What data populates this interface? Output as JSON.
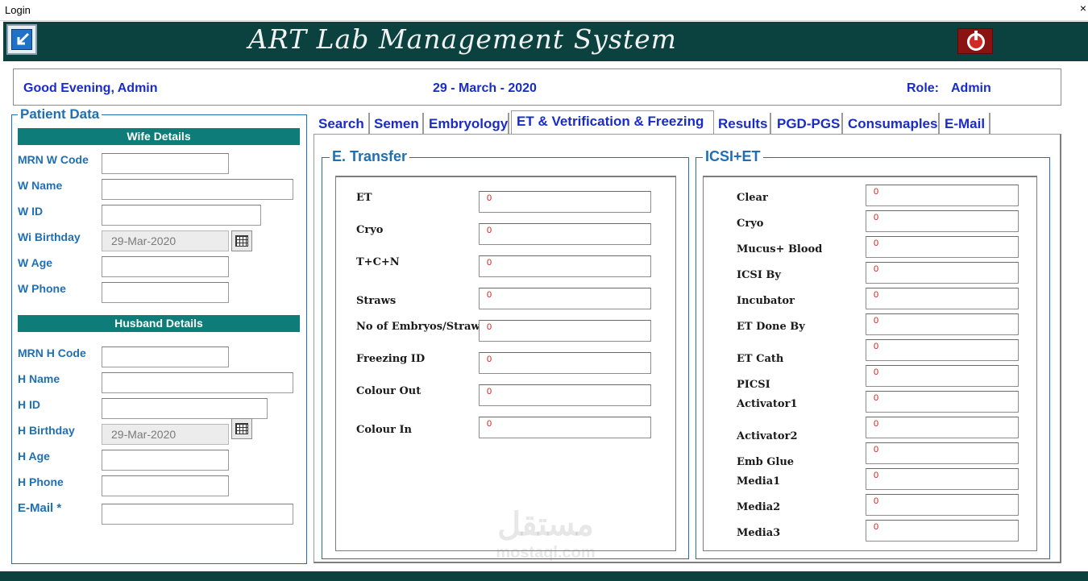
{
  "window": {
    "title": "Login",
    "close_glyph": "×"
  },
  "header": {
    "app_title": "ART Lab Management System",
    "back_icon": "back-arrow-icon",
    "power_icon": "power-icon",
    "colors": {
      "header_bg": "#0b423f",
      "accent_teal": "#0e7d7a",
      "label_blue": "#1f6fb3",
      "text_blue": "#1a2cc6",
      "value_red": "#d11a1a"
    }
  },
  "infobar": {
    "greeting": "Good Evening, Admin",
    "date": "29 - March - 2020",
    "role_label": "Role:",
    "role_value": "Admin"
  },
  "patient": {
    "legend": "Patient Data",
    "wife_header": "Wife Details",
    "wife_fields": [
      {
        "label": "MRN W Code",
        "value": ""
      },
      {
        "label": "W Name",
        "value": ""
      },
      {
        "label": "W ID",
        "value": ""
      },
      {
        "label": "Wi Birthday",
        "value": "29-Mar-2020"
      },
      {
        "label": "W Age",
        "value": ""
      },
      {
        "label": "W Phone",
        "value": ""
      }
    ],
    "husband_header": "Husband Details",
    "husband_fields": [
      {
        "label": "MRN H Code",
        "value": ""
      },
      {
        "label": "H Name",
        "value": ""
      },
      {
        "label": "H ID",
        "value": ""
      },
      {
        "label": "H Birthday",
        "value": "29-Mar-2020"
      },
      {
        "label": "H Age",
        "value": ""
      },
      {
        "label": "H Phone",
        "value": ""
      },
      {
        "label": "E-Mail *",
        "value": ""
      }
    ]
  },
  "tabs": [
    {
      "label": "Search",
      "active": false
    },
    {
      "label": "Semen",
      "active": false
    },
    {
      "label": "Embryology",
      "active": false
    },
    {
      "label": "ET & Vetrification & Freezing",
      "active": true
    },
    {
      "label": "Results",
      "active": false
    },
    {
      "label": "PGD-PGS",
      "active": false
    },
    {
      "label": "Consumaples",
      "active": false
    },
    {
      "label": "E-Mail",
      "active": false
    }
  ],
  "et_panel": {
    "legend": "E. Transfer",
    "fields": [
      {
        "label": "ET",
        "value": "0"
      },
      {
        "label": "Cryo",
        "value": "0"
      },
      {
        "label": "T+C+N",
        "value": "0"
      },
      {
        "label": "Straws",
        "value": "0"
      },
      {
        "label": "No of Embryos/Straw",
        "value": "0"
      },
      {
        "label": "Freezing ID",
        "value": "0"
      },
      {
        "label": "Colour Out",
        "value": "0"
      },
      {
        "label": "Colour In",
        "value": "0"
      }
    ]
  },
  "icsi_panel": {
    "legend": "ICSI+ET",
    "fields": [
      {
        "label": "Clear",
        "value": "0"
      },
      {
        "label": "Cryo",
        "value": "0"
      },
      {
        "label": "Mucus+ Blood",
        "value": "0"
      },
      {
        "label": "ICSI By",
        "value": "0"
      },
      {
        "label": "Incubator",
        "value": "0"
      },
      {
        "label": "ET Done By",
        "value": "0"
      },
      {
        "label": "ET Cath",
        "value": "0"
      },
      {
        "label": "PICSI",
        "value": "0"
      },
      {
        "label": "Activator1",
        "value": "0"
      },
      {
        "label": "Activator2",
        "value": "0"
      },
      {
        "label": "Emb Glue",
        "value": "0"
      },
      {
        "label": "Media1",
        "value": "0"
      },
      {
        "label": "Media2",
        "value": "0"
      },
      {
        "label": "Media3",
        "value": "0"
      }
    ]
  },
  "watermark": {
    "arabic": "مستقل",
    "latin": "mostaql.com"
  }
}
